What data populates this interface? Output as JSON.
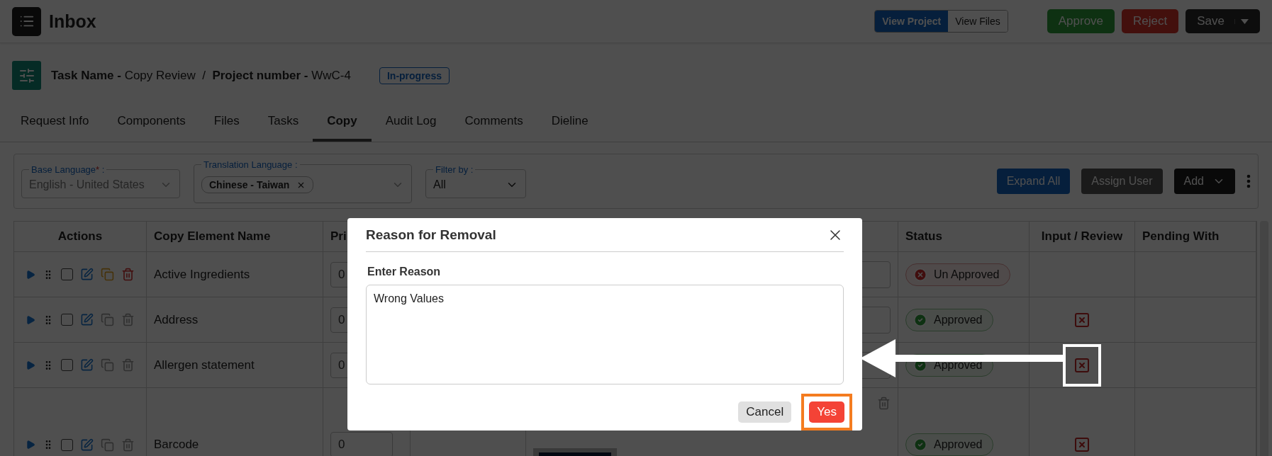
{
  "header": {
    "title": "Inbox",
    "view_buttons": [
      {
        "label": "View Project",
        "selected": true
      },
      {
        "label": "View Files",
        "selected": false
      }
    ],
    "actions": [
      {
        "label": "Approve",
        "kind": "approve"
      },
      {
        "label": "Reject",
        "kind": "reject"
      },
      {
        "label": "Save",
        "kind": "split"
      }
    ]
  },
  "task": {
    "text": "**Task Name -** Copy Review  /  **Project number -** WwC-4",
    "status": "In-progress"
  },
  "tabs": [
    {
      "label": "Request Info",
      "selected": false
    },
    {
      "label": "Components",
      "selected": false
    },
    {
      "label": "Files",
      "selected": false
    },
    {
      "label": "Tasks",
      "selected": false
    },
    {
      "label": "Copy",
      "selected": true
    },
    {
      "label": "Audit Log",
      "selected": false
    },
    {
      "label": "Comments",
      "selected": false
    },
    {
      "label": "Dieline",
      "selected": false
    }
  ],
  "filters": {
    "base_language": {
      "label": "Base Language",
      "required_mark": "*",
      "label_end": " :",
      "value": "English - United States",
      "disabled": true
    },
    "translation_language": {
      "label": "Translation Language :",
      "chips": [
        "Chinese - Taiwan"
      ]
    },
    "filter_by": {
      "label": "Filter by :",
      "value": "All"
    },
    "buttons": [
      {
        "label": "Expand All",
        "kind": "primary"
      },
      {
        "label": "Assign User",
        "kind": "secondary"
      },
      {
        "label": "Add",
        "kind": "dropdown"
      }
    ]
  },
  "table": {
    "columns": [
      "Actions",
      "Copy Element Name",
      "Pri",
      "Status",
      "Input / Review",
      "Pending With"
    ],
    "rows": [
      {
        "kind": "text",
        "name": "Active Ingredients",
        "priority": "0",
        "checked": false,
        "actions_enabled": true,
        "status": {
          "label": "Un Approved",
          "kind": "unapproved"
        },
        "review_icon": false,
        "highlighted": false
      },
      {
        "kind": "text",
        "name": "Address",
        "priority": "0",
        "checked": false,
        "actions_enabled": false,
        "status": {
          "label": "Approved",
          "kind": "approved"
        },
        "review_icon": true,
        "highlighted": false
      },
      {
        "kind": "text",
        "name": "Allergen statement",
        "priority": "0",
        "checked": false,
        "actions_enabled": false,
        "status": {
          "label": "Approved",
          "kind": "approved"
        },
        "review_icon": true,
        "highlighted": true
      },
      {
        "kind": "picture",
        "name": "Barcode",
        "priority": "0",
        "checked": false,
        "actions_enabled": false,
        "status": {
          "label": "Approved",
          "kind": "approved"
        },
        "review_icon": true,
        "highlighted": false
      }
    ]
  },
  "modal": {
    "title": "Reason for Removal",
    "label": "Enter Reason",
    "value": "Wrong Values",
    "buttons": [
      {
        "label": "Cancel",
        "kind": "cancel",
        "highlighted": false
      },
      {
        "label": "Yes",
        "kind": "confirm",
        "highlighted": true
      }
    ]
  }
}
